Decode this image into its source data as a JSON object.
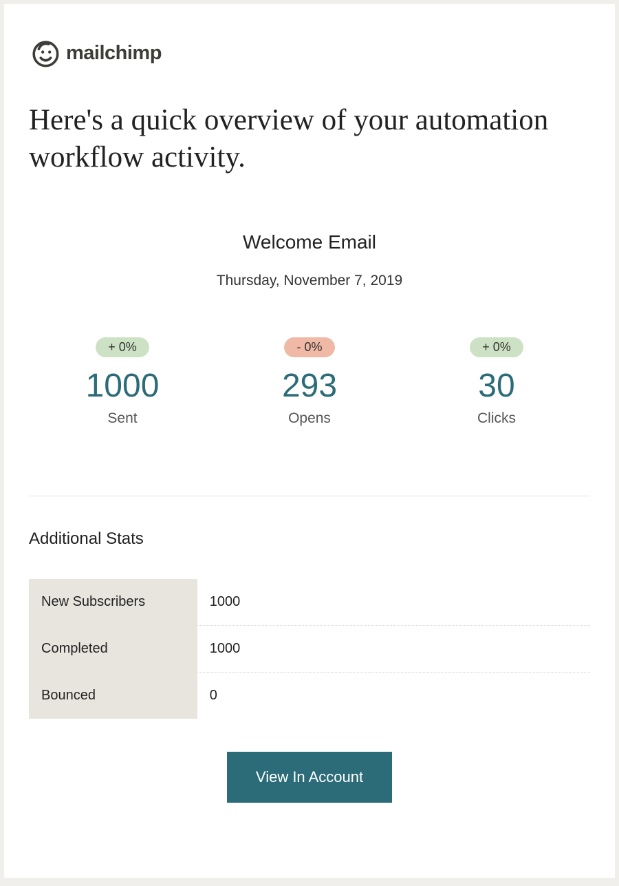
{
  "brand": {
    "name": "mailchimp"
  },
  "headline": "Here's a quick overview of your automation workflow activity.",
  "campaign": {
    "title": "Welcome Email",
    "date": "Thursday, November 7, 2019"
  },
  "metrics": [
    {
      "delta": "+ 0%",
      "pill_color": "green",
      "value": "1000",
      "label": "Sent"
    },
    {
      "delta": "- 0%",
      "pill_color": "red",
      "value": "293",
      "label": "Opens"
    },
    {
      "delta": "+ 0%",
      "pill_color": "green",
      "value": "30",
      "label": "Clicks"
    }
  ],
  "additional": {
    "heading": "Additional Stats",
    "rows": [
      {
        "label": "New Subscribers",
        "value": "1000"
      },
      {
        "label": "Completed",
        "value": "1000"
      },
      {
        "label": "Bounced",
        "value": "0"
      }
    ]
  },
  "cta": {
    "label": "View In Account"
  }
}
